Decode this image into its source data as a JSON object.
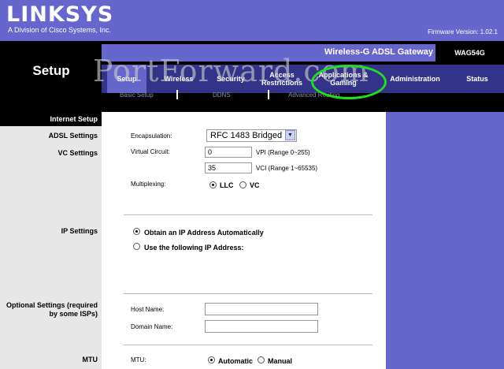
{
  "brand": {
    "logo": "LINKSYS",
    "tagline": "A Division of Cisco Systems, Inc."
  },
  "firmware": "Firmware Version: 1.02.1",
  "product": {
    "name": "Wireless-G ADSL Gateway",
    "model": "WAG54G"
  },
  "page_title": "Setup",
  "watermark": "PortForward.com",
  "nav": {
    "tabs": [
      "Setup",
      "Wireless",
      "Security",
      "Access Restrictions",
      "Applications & Gaming",
      "Administration",
      "Status"
    ],
    "subtabs": [
      "Basic Setup",
      "DDNS",
      "Advanced Routing"
    ]
  },
  "sections": {
    "internet_setup": "Internet Setup",
    "adsl": "ADSL Settings",
    "vc": "VC Settings",
    "ip": "IP Settings",
    "optional": "Optional Settings (required by some ISPs)",
    "mtu": "MTU"
  },
  "form": {
    "encapsulation_label": "Encapsulation:",
    "encapsulation_value": "RFC 1483 Bridged",
    "vc_label": "Virtual Circuit:",
    "vpi_value": "0",
    "vpi_hint": "VPI (Range 0~255)",
    "vci_value": "35",
    "vci_hint": "VCI (Range 1~65535)",
    "multiplexing_label": "Multiplexing:",
    "mux_llc": "LLC",
    "mux_vc": "VC",
    "ip_auto": "Obtain an IP Address Automatically",
    "ip_static": "Use the following IP Address:",
    "host_label": "Host Name:",
    "domain_label": "Domain Name:",
    "host_value": "",
    "domain_value": "",
    "mtu_label": "MTU:",
    "mtu_auto": "Automatic",
    "mtu_manual": "Manual"
  },
  "colors": {
    "header": "#6666cc",
    "nav": "#33338a",
    "highlight_circle": "#22dd22"
  }
}
